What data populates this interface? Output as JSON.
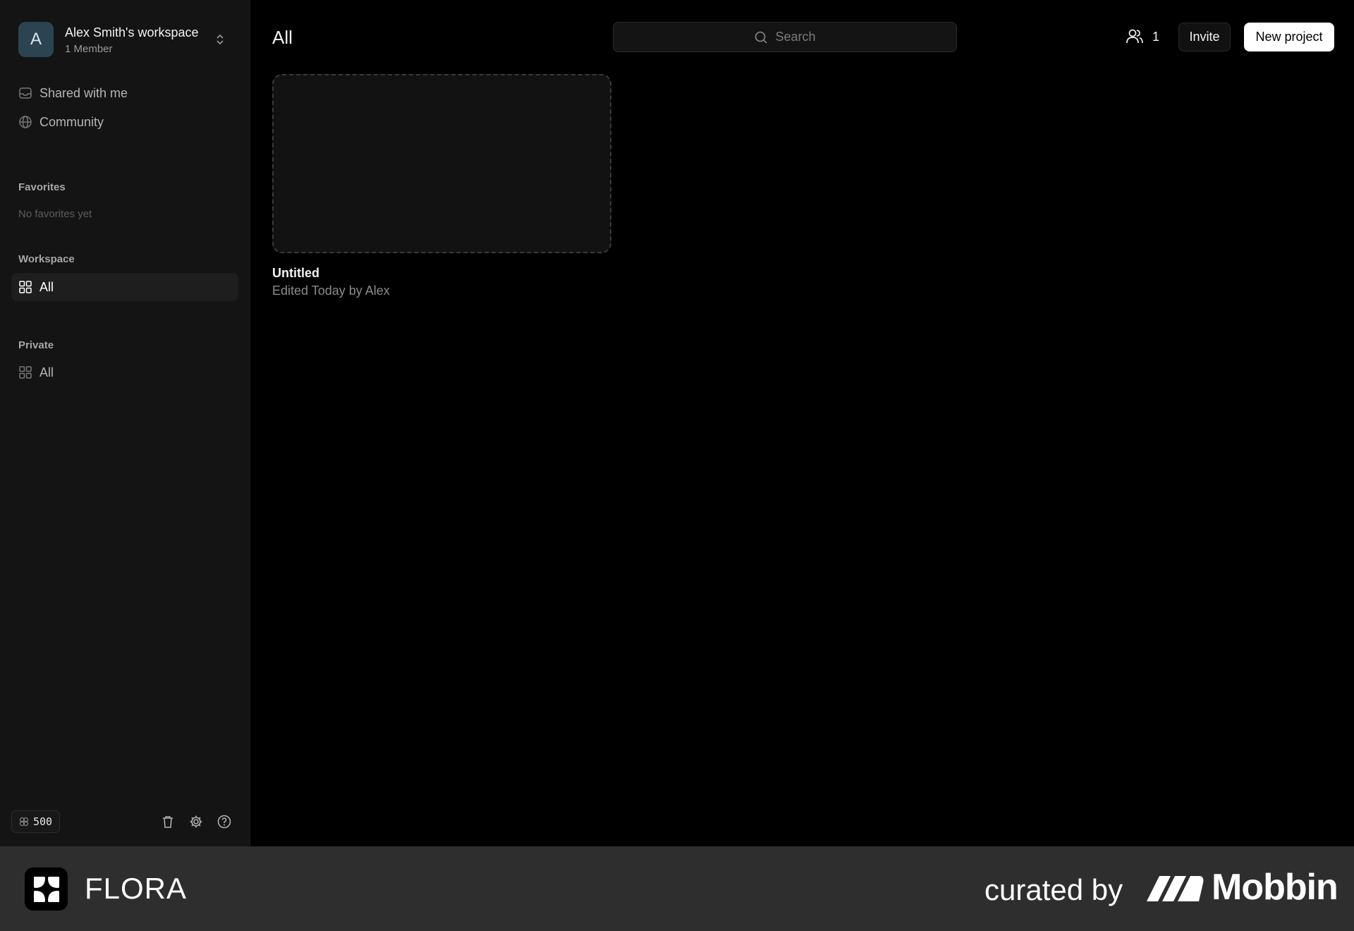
{
  "workspace": {
    "avatar_letter": "A",
    "name": "Alex Smith's workspace",
    "members": "1 Member"
  },
  "nav": {
    "shared_with_me": "Shared with me",
    "community": "Community"
  },
  "favorites": {
    "label": "Favorites",
    "empty": "No favorites yet"
  },
  "workspace_section": {
    "label": "Workspace",
    "all": "All"
  },
  "private_section": {
    "label": "Private",
    "all": "All"
  },
  "footer": {
    "credits": "500"
  },
  "header": {
    "title": "All",
    "search_placeholder": "Search",
    "member_count": "1",
    "invite": "Invite",
    "new_project": "New project"
  },
  "projects": [
    {
      "title": "Untitled",
      "meta": "Edited Today by Alex"
    }
  ],
  "banner": {
    "app_name": "FLORA",
    "curated_by": "curated by",
    "brand": "Mobbin"
  },
  "colors": {
    "background": "#000000",
    "sidebar": "#141414",
    "avatar": "#2b4450",
    "banner": "#2e2e2e"
  }
}
